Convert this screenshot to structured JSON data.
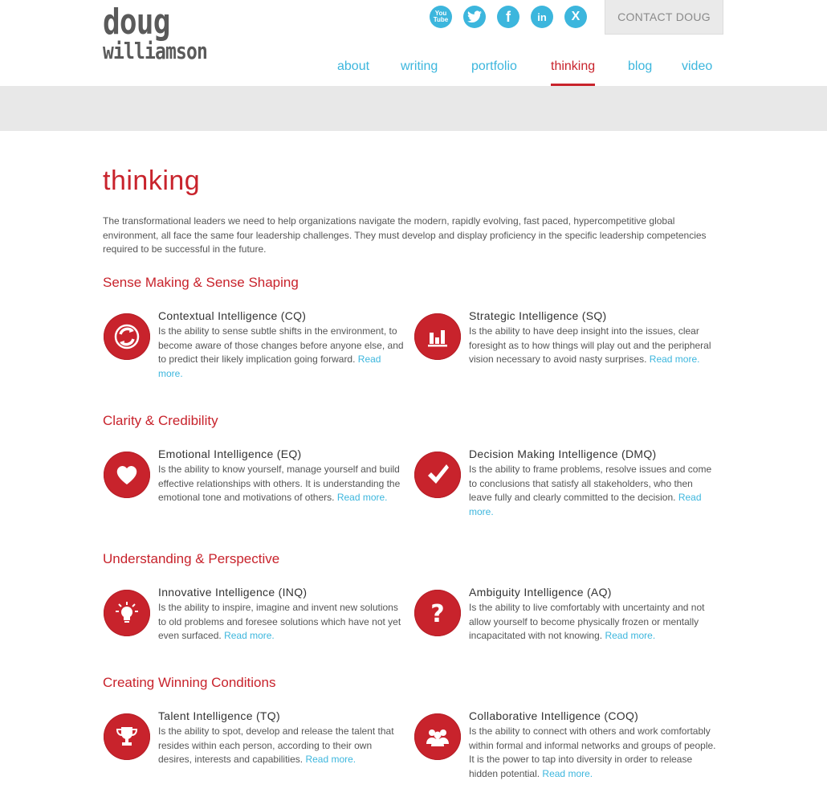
{
  "logo": {
    "line1": "doug",
    "line2": "williamson"
  },
  "social": {
    "youtube": "You\nTube",
    "twitter": "t",
    "facebook": "f",
    "linkedin": "in",
    "x": "X"
  },
  "header": {
    "contact": "CONTACT DOUG"
  },
  "nav": [
    {
      "label": "about",
      "active": false
    },
    {
      "label": "writing",
      "active": false
    },
    {
      "label": "portfolio",
      "active": false
    },
    {
      "label": "thinking",
      "active": true
    },
    {
      "label": "blog",
      "active": false
    },
    {
      "label": "video",
      "active": false
    }
  ],
  "page": {
    "title": "thinking",
    "intro": "The transformational leaders we need to help organizations navigate the modern, rapidly evolving, fast paced, hypercompetitive global environment, all face the same four leadership challenges. They must develop and display proficiency in the specific leadership competencies required to be successful in the future."
  },
  "sections": [
    {
      "title": "Sense Making & Sense Shaping",
      "items": [
        {
          "icon": "refresh-icon",
          "title": "Contextual Intelligence (CQ)",
          "desc": "Is the ability to sense subtle shifts in the environment, to become aware of those changes before anyone else, and to predict their likely implication going forward.",
          "more": "Read more."
        },
        {
          "icon": "bar-chart-icon",
          "title": "Strategic Intelligence (SQ)",
          "desc": "Is the ability to have deep insight into the issues, clear foresight as to how things will play out and the peripheral vision necessary to avoid nasty surprises.",
          "more": "Read more."
        }
      ]
    },
    {
      "title": "Clarity & Credibility",
      "items": [
        {
          "icon": "heart-icon",
          "title": "Emotional Intelligence (EQ)",
          "desc": "Is the ability to know yourself, manage yourself and build effective relationships with others. It is understanding the emotional tone and motivations of others.",
          "more": "Read more."
        },
        {
          "icon": "checkmark-icon",
          "title": "Decision Making Intelligence (DMQ)",
          "desc": "Is the ability to frame problems, resolve issues and come to conclusions that satisfy all stakeholders, who then leave fully and clearly committed to the decision.",
          "more": "Read more."
        }
      ]
    },
    {
      "title": "Understanding & Perspective",
      "items": [
        {
          "icon": "lightbulb-icon",
          "title": "Innovative Intelligence (INQ)",
          "desc": "Is the ability to inspire, imagine and invent new solutions to old problems and foresee solutions which have not yet even surfaced.",
          "more": "Read more."
        },
        {
          "icon": "question-icon",
          "title": "Ambiguity Intelligence (AQ)",
          "desc": "Is the ability to live comfortably with uncertainty and not allow yourself to become physically frozen or mentally incapacitated with not knowing.",
          "more": "Read more."
        }
      ]
    },
    {
      "title": "Creating Winning Conditions",
      "items": [
        {
          "icon": "trophy-icon",
          "title": "Talent Intelligence (TQ)",
          "desc": "Is the ability to spot, develop and release the talent that resides within each person, according to their own desires, interests and capabilities.",
          "more": "Read more."
        },
        {
          "icon": "people-icon",
          "title": "Collaborative Intelligence (COQ)",
          "desc": "Is the ability to connect with others and work comfortably within formal and informal networks and groups of people. It is the power to tap into diversity in order to release hidden potential.",
          "more": "Read more."
        }
      ]
    }
  ]
}
